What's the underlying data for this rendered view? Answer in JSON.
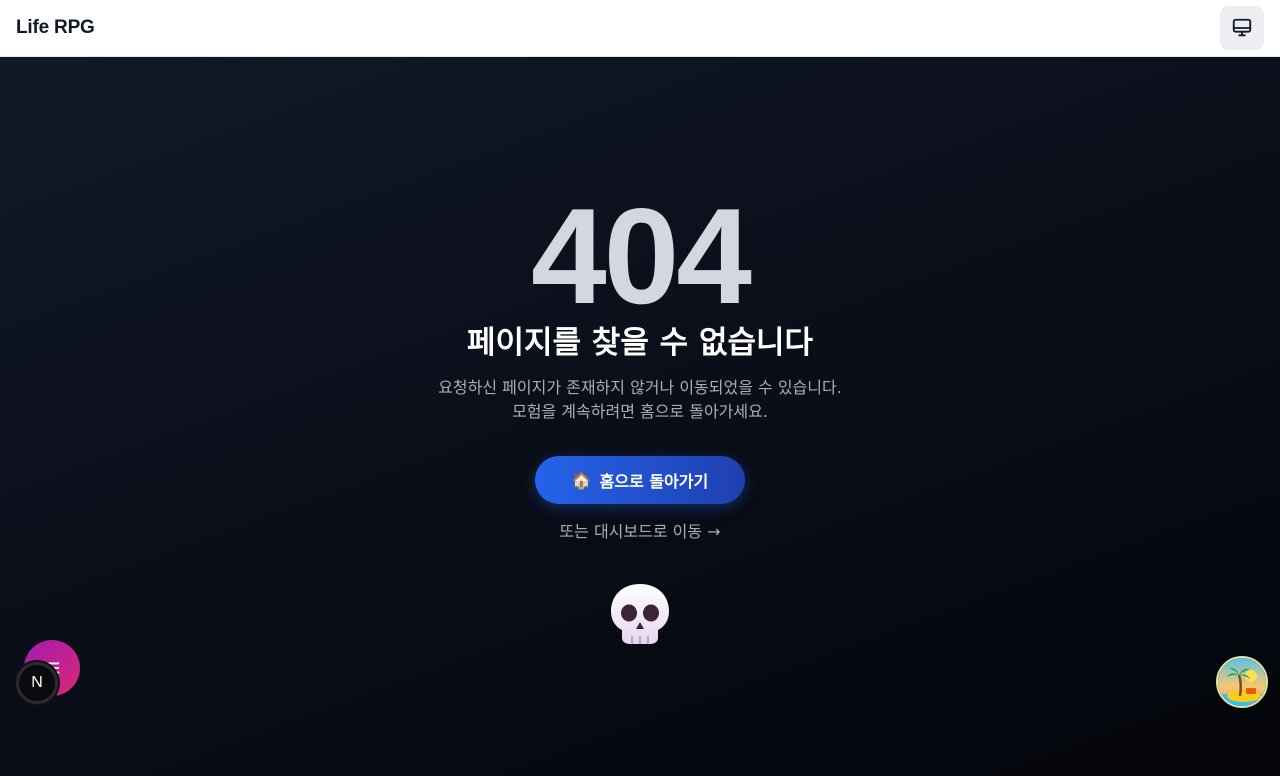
{
  "header": {
    "brand": "Life RPG",
    "display_toggle_icon": "monitor-icon"
  },
  "error": {
    "code": "404",
    "title": "페이지를 찾을 수 없습니다",
    "description_line1": "요청하신 페이지가 존재하지 않거나 이동되었을 수 있습니다.",
    "description_line2": "모험을 계속하려면 홈으로 돌아가세요."
  },
  "actions": {
    "home_icon": "🏠",
    "home_label": "홈으로 돌아가기",
    "dashboard_link": "또는 대시보드로 이동 →"
  },
  "decor": {
    "skull_icon": "skull-icon"
  },
  "floating": {
    "menu_icon": "menu-icon",
    "dev_badge": "N",
    "island_icon": "island-icon"
  },
  "colors": {
    "primary": "#2563eb",
    "primary_dark": "#1e40af",
    "background": "#0b0f1a",
    "fab": "#c026d3"
  }
}
